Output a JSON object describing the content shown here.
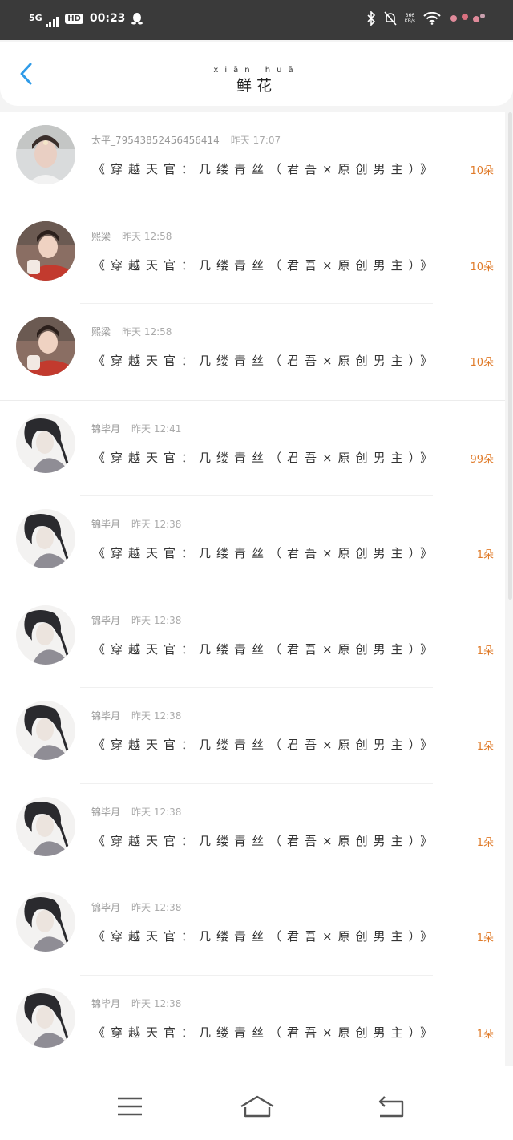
{
  "status_bar": {
    "network": "5G",
    "hd": "HD",
    "time": "00:23",
    "speed_value": "366",
    "speed_unit": "KB/s"
  },
  "header": {
    "title": "鲜花",
    "title_pinyin": "xiān huā",
    "back_icon": "chevron-left-icon"
  },
  "gifts": [
    {
      "name": "太平_79543852456456414",
      "time": "昨天 17:07",
      "book": "《穿越天官：几缕青丝（君吾×原创男主）》",
      "count": "10",
      "unit": "朵",
      "avatar": "photo-woman-white"
    },
    {
      "name": "熙梁",
      "time": "昨天 12:58",
      "book": "《穿越天官：几缕青丝（君吾×原创男主）》",
      "count": "10",
      "unit": "朵",
      "avatar": "photo-woman-red"
    },
    {
      "name": "熙梁",
      "time": "昨天 12:58",
      "book": "《穿越天官：几缕青丝（君吾×原创男主）》",
      "count": "10",
      "unit": "朵",
      "avatar": "photo-woman-red"
    },
    {
      "name": "锦毕月",
      "time": "昨天 12:41",
      "book": "《穿越天官：几缕青丝（君吾×原创男主）》",
      "count": "99",
      "unit": "朵",
      "avatar": "illustration-man"
    },
    {
      "name": "锦毕月",
      "time": "昨天 12:38",
      "book": "《穿越天官：几缕青丝（君吾×原创男主）》",
      "count": "1",
      "unit": "朵",
      "avatar": "illustration-man"
    },
    {
      "name": "锦毕月",
      "time": "昨天 12:38",
      "book": "《穿越天官：几缕青丝（君吾×原创男主）》",
      "count": "1",
      "unit": "朵",
      "avatar": "illustration-man"
    },
    {
      "name": "锦毕月",
      "time": "昨天 12:38",
      "book": "《穿越天官：几缕青丝（君吾×原创男主）》",
      "count": "1",
      "unit": "朵",
      "avatar": "illustration-man"
    },
    {
      "name": "锦毕月",
      "time": "昨天 12:38",
      "book": "《穿越天官：几缕青丝（君吾×原创男主）》",
      "count": "1",
      "unit": "朵",
      "avatar": "illustration-man"
    },
    {
      "name": "锦毕月",
      "time": "昨天 12:38",
      "book": "《穿越天官：几缕青丝（君吾×原创男主）》",
      "count": "1",
      "unit": "朵",
      "avatar": "illustration-man"
    },
    {
      "name": "锦毕月",
      "time": "昨天 12:38",
      "book": "《穿越天官：几缕青丝（君吾×原创男主）》",
      "count": "1",
      "unit": "朵",
      "avatar": "illustration-man"
    }
  ],
  "colors": {
    "accent": "#2f9be8",
    "count": "#e07b2a",
    "status_bar": "#3a3a3a"
  },
  "navbar": {
    "menu_icon": "menu-icon",
    "home_icon": "home-icon",
    "back_icon": "back-icon"
  }
}
